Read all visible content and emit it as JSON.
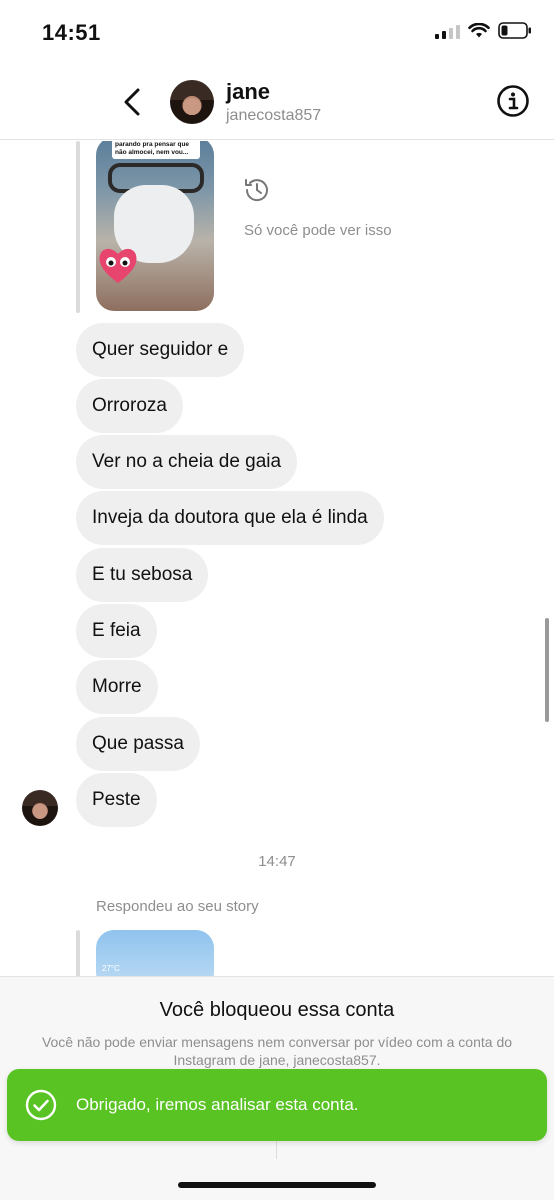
{
  "status_bar": {
    "time": "14:51"
  },
  "header": {
    "name": "jane",
    "username": "janecosta857"
  },
  "story_reply_top": {
    "caption": "parando pra pensar que não almocei, nem vou...",
    "notice": "Só você pode ver isso"
  },
  "messages": [
    "Quer seguidor e",
    "Orroroza",
    "Ver no a cheia de gaia",
    "Inveja da doutora que ela é linda",
    "E tu sebosa",
    "E feia",
    "Morre",
    "Que passa",
    "Peste"
  ],
  "timestamp": "14:47",
  "story_reply_bottom": {
    "label": "Respondeu ao seu story",
    "temperature": "27°C"
  },
  "blocked": {
    "title": "Você bloqueou essa conta",
    "description": "Você não pode enviar mensagens nem conversar por vídeo com a conta do Instagram de jane, janecosta857."
  },
  "toast": {
    "message": "Obrigado, iremos analisar esta conta."
  },
  "colors": {
    "toast": "#58c322",
    "bubble": "#efefef",
    "muted_text": "#8e8e8e"
  }
}
